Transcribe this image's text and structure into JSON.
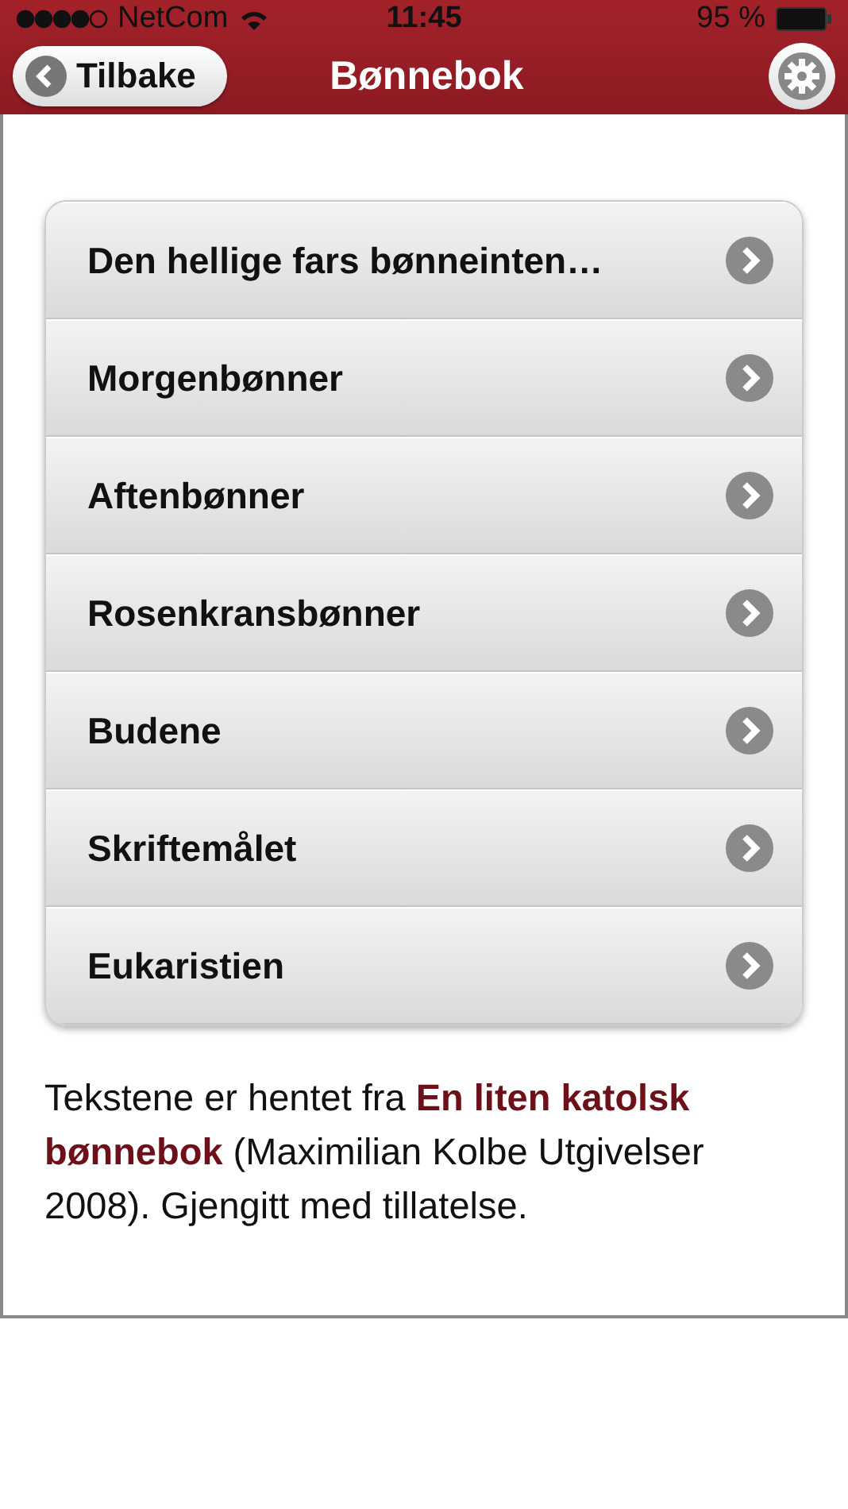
{
  "status_bar": {
    "carrier": "NetCom",
    "time": "11:45",
    "battery": "95 %"
  },
  "nav_bar": {
    "back_button": "Tilbake",
    "title": "Bønnebok"
  },
  "menu": [
    {
      "label": "Den hellige fars bønneinten…"
    },
    {
      "label": "Morgenbønner"
    },
    {
      "label": "Aftenbønner"
    },
    {
      "label": "Rosenkransbønner"
    },
    {
      "label": "Budene"
    },
    {
      "label": "Skriftemålet"
    },
    {
      "label": "Eukaristien"
    }
  ],
  "footer_text": "Tekstene er hentet fra **En liten katolsk bønnebok** (Maximilian Kolbe Utgivelser 2008). Gjengitt med tillatelse."
}
